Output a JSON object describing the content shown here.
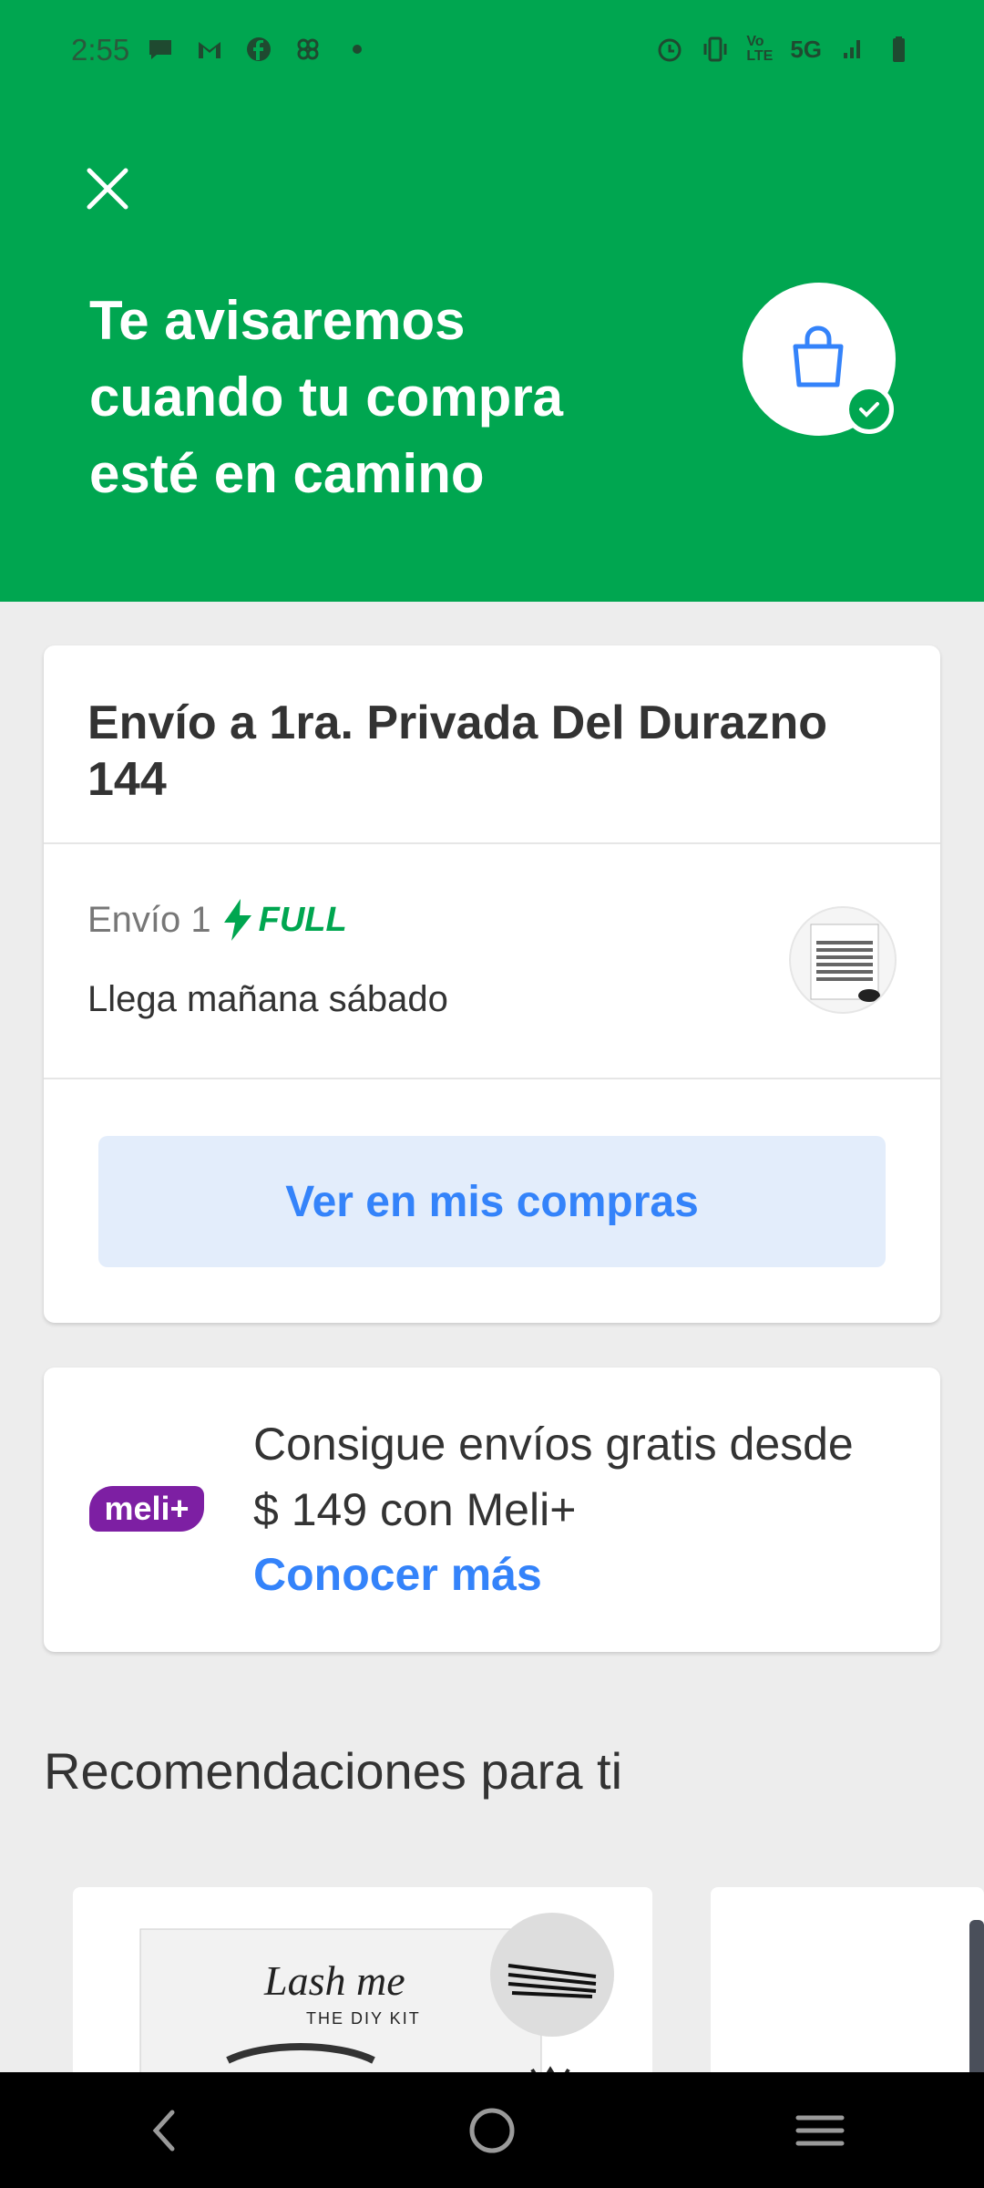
{
  "status_bar": {
    "time": "2:55",
    "network": "5G",
    "volte": "Vo LTE",
    "icons": [
      "chat-icon",
      "gmail-icon",
      "facebook-icon",
      "pinwheel-icon",
      "dot-icon",
      "alarm-icon",
      "vibrate-icon",
      "signal-icon",
      "battery-icon"
    ]
  },
  "header": {
    "headline": "Te avisaremos cuando tu compra esté en camino",
    "accent_color": "#00a650"
  },
  "shipment_card": {
    "address_title": "Envío a 1ra. Privada Del Durazno 144",
    "shipment_label": "Envío 1",
    "full_badge": "FULL",
    "arrival": "Llega mañana sábado",
    "view_button": "Ver en mis compras"
  },
  "promo_card": {
    "logo_text": "meli+",
    "text": "Consigue envíos gratis desde $ 149 con Meli+",
    "link": "Conocer más"
  },
  "recommendations": {
    "title": "Recomendaciones para ti",
    "items": [
      {
        "brand": "Lash me",
        "subtitle": "THE DIY KIT"
      }
    ]
  },
  "nav_bar": {
    "buttons": [
      "back",
      "home",
      "recents"
    ]
  }
}
